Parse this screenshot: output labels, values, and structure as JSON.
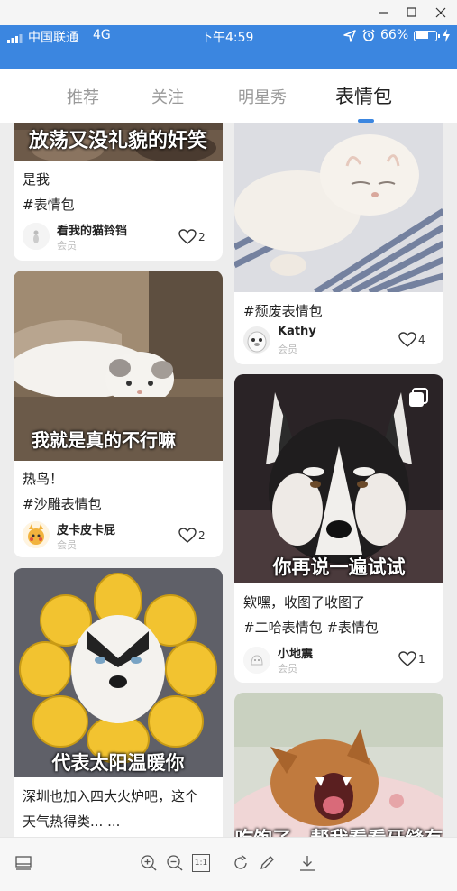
{
  "status_bar": {
    "carrier": "中国联通",
    "network": "4G",
    "time": "下午4:59",
    "battery_text": "66%",
    "battery_level": 0.66,
    "icons": [
      "signal-icon",
      "location-icon",
      "alarm-icon",
      "battery-icon",
      "charging-icon"
    ]
  },
  "window_controls": [
    "minimize-icon",
    "maximize-icon",
    "close-icon"
  ],
  "tabs": [
    {
      "label": "推荐",
      "active": false
    },
    {
      "label": "关注",
      "active": false
    },
    {
      "label": "明星秀",
      "active": false
    },
    {
      "label": "表情包",
      "active": true
    }
  ],
  "accent_color": "#3b86e0",
  "cards": [
    {
      "caption": "放荡又没礼貌的奸笑",
      "desc": "是我",
      "tags": "#表情包",
      "author": "看我的猫铃铛",
      "member": "会员",
      "likes": "2"
    },
    {
      "caption": "",
      "desc": "",
      "tags": "#颓废表情包",
      "author": "Kathy",
      "member": "会员",
      "likes": "4"
    },
    {
      "caption": "我就是真的不行嘛",
      "desc": "热鸟！",
      "tags": "#沙雕表情包",
      "author": "皮卡皮卡屁",
      "member": "会员",
      "likes": "2"
    },
    {
      "caption": "你再说一遍试试",
      "desc": "欸嘿，收图了收图了",
      "tags": "#二哈表情包 #表情包",
      "author": "小地震",
      "member": "会员",
      "likes": "1",
      "multi_image_icon": "multi-image-icon"
    },
    {
      "caption": "代表太阳温暖你",
      "desc_line1": "深圳也加入四大火炉吧，这个",
      "desc_line2": "天气热得类... ..."
    },
    {
      "caption": "吃饱了，帮我看看牙缝有"
    }
  ],
  "toolbar": {
    "icons": [
      "layout-icon",
      "zoom-in-icon",
      "zoom-out-icon",
      "actual-size-icon",
      "rotate-icon",
      "edit-icon",
      "download-icon"
    ],
    "actual_size_label": "1:1"
  }
}
